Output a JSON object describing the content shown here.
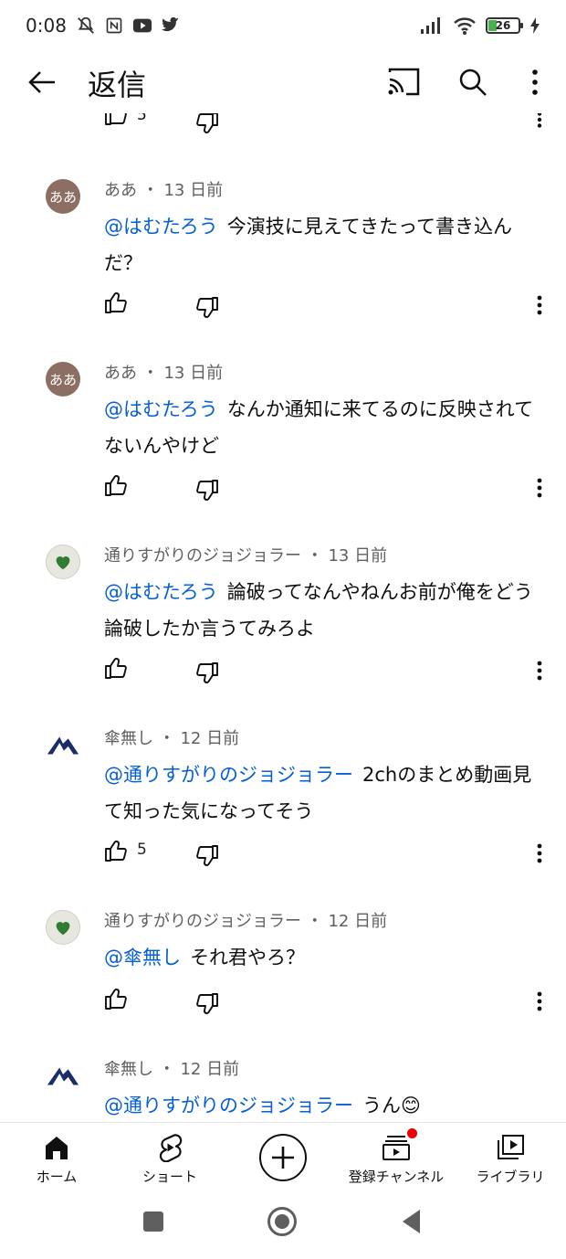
{
  "status_bar": {
    "time": "0:08",
    "battery": "26"
  },
  "header": {
    "title": "返信"
  },
  "comments": [
    {
      "author": "ああ",
      "time": "13 日前",
      "avatar_text": "ああ",
      "mention": "@はむたろう",
      "body": "今演技に見えてきたって書き込んだ？",
      "likes": ""
    },
    {
      "author": "ああ",
      "time": "13 日前",
      "avatar_text": "ああ",
      "mention": "@はむたろう",
      "body": "なんか通知に来てるのに反映されてないんやけど",
      "likes": ""
    },
    {
      "author": "通りすがりのジョジョラー",
      "time": "13 日前",
      "mention": "@はむたろう",
      "body": "論破ってなんやねんお前が俺をどう論破したか言うてみろよ",
      "likes": ""
    },
    {
      "author": "傘無し",
      "time": "12 日前",
      "mention": "@通りすがりのジョジョラー",
      "body": "2chのまとめ動画見て知った気になってそう",
      "likes": "5"
    },
    {
      "author": "通りすがりのジョジョラー",
      "time": "12 日前",
      "mention": "@傘無し",
      "body": "それ君やろ？",
      "likes": ""
    },
    {
      "author": "傘無し",
      "time": "12 日前",
      "mention": "@通りすがりのジョジョラー",
      "body": "うん😊",
      "likes": ""
    }
  ],
  "partial_top": {
    "likes": "5"
  },
  "bottom_nav": {
    "home": "ホーム",
    "shorts": "ショート",
    "subscriptions": "登録チャンネル",
    "library": "ライブラリ"
  },
  "colors": {
    "mention": "#065fd4",
    "meta": "#606060",
    "badge": "#e00"
  }
}
